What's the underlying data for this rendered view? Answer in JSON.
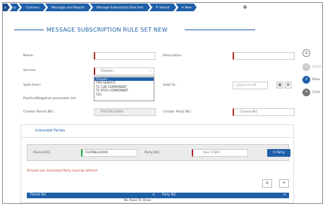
{
  "topbar": {
    "home_icon": "home-icon",
    "crumbs": [
      "Common",
      "Messages and Reports",
      "Message Subscription Rule Sets",
      "Search",
      "New"
    ],
    "search_icon": "search-icon",
    "plus_icon": "plus-icon"
  },
  "page": {
    "title": "MESSAGE SUBSCRIPTION RULE SET NEW"
  },
  "form": {
    "name_label": "Name:",
    "name_value": "",
    "description_label": "Description:",
    "description_value": "",
    "service_label": "Service:",
    "service_selected": "Choose...",
    "service_options": [
      "Choose...",
      "TIPS SERVICE",
      "T2 CLM COMPONENT",
      "T2 RTGS COMPONENT",
      "T2S"
    ],
    "valid_from_label": "Valid From:",
    "valid_to_label": "Valid To:",
    "valid_to_placeholder": "yyyy-mm-dd",
    "pos_neg_label": "Positive/Negative parameter set:",
    "creator_parent_label": "Creator Parent BIC:",
    "creator_parent_value": "TRGTXE2SXXX",
    "creator_party_label": "Creator Party BIC:",
    "creator_party_placeholder": "Choose BIC"
  },
  "actions": {
    "submit_label": "Subm",
    "reset_label": "Rese",
    "cancel_label": "Canc"
  },
  "interested": {
    "panel_title": "Interested Parties",
    "parent_bic_label": "Parent BIC:",
    "parent_bic_value": "FLORNL2AXXX",
    "party_bic_label": "Party BIC:",
    "party_bic_placeholder": "Your 11BIC",
    "party_button_label": "Party",
    "error_text": "At least one interested Party must be defined",
    "col_parent": "Parent BIC",
    "col_party": "Party BIC",
    "no_rows": "No Rows To Show"
  },
  "colors": {
    "accent": "#1f5fa8",
    "required": "#b51f2e",
    "error": "#c0392b"
  }
}
